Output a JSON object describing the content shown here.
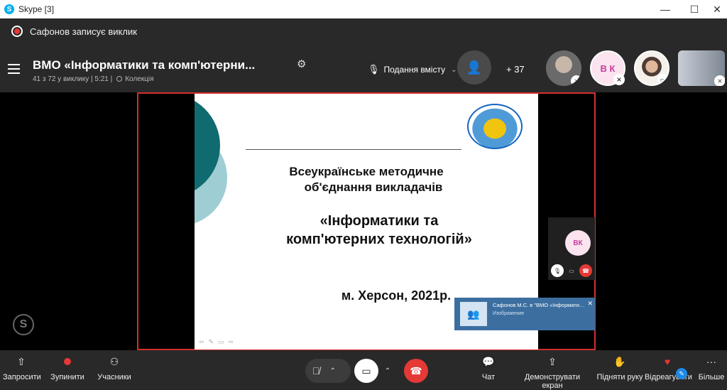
{
  "window": {
    "title": "Skype [3]",
    "app_icon": "S",
    "minimize": "—",
    "maximize": "☐",
    "close": "✕"
  },
  "recording": {
    "text": "Сафонов записує виклик"
  },
  "header": {
    "title": "ВМО «Інформатики та комп'ютерни...",
    "subtitle": "41 з 72 у виклику | 5:21 |",
    "collection": "Колекція",
    "present_label": "Подання вмісту",
    "participants_more": "+ 37",
    "avatar2_initials": "В К"
  },
  "slide": {
    "line1": "Всеукраїнське методичне",
    "line2": "об'єднання викладачів",
    "line3": "«Інформатики та",
    "line4": "комп'ютерних технологій»",
    "line5": "м. Херсон, 2021р."
  },
  "selfview": {
    "initials": "ВК"
  },
  "notification": {
    "title": "Сафонов М.С. в \"ВМО «Інформатики ...",
    "subtitle": "Изображение"
  },
  "toolbar": {
    "share_label": "Запросити",
    "stop_label": "Зупинити",
    "participants_label": "Учасники",
    "chat_label": "Чат",
    "screen_label": "Демонструвати екран",
    "hand_label": "Підняти руку",
    "react_label": "Відреагувати",
    "more_label": "Більше"
  },
  "colors": {
    "accent_red": "#e53935",
    "share_border": "#d32f2f",
    "notification_bg": "#3c6fa0"
  },
  "icons": {
    "share": "share-icon",
    "record": "record-icon",
    "participants": "participants-icon",
    "mic_muted": "mic-muted-icon",
    "video": "video-icon",
    "hangup": "hangup-icon",
    "chat": "chat-icon",
    "screen": "screen-share-icon",
    "hand": "raise-hand-icon",
    "react": "heart-icon",
    "more": "more-icon"
  }
}
